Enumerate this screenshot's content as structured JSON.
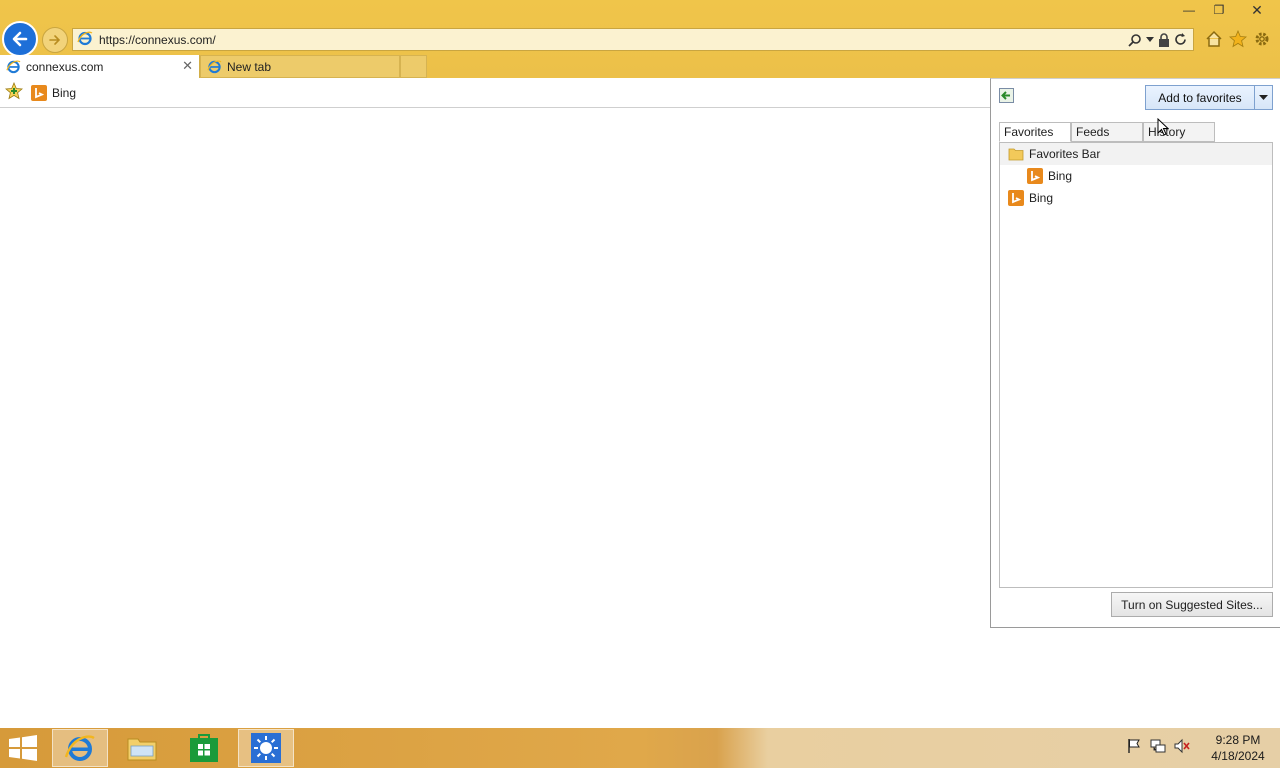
{
  "window": {
    "minimize_glyph": "—",
    "restore_glyph": "❐",
    "close_glyph": "✕"
  },
  "address": {
    "url": "https://connexus.com/"
  },
  "tabs": [
    {
      "label": "connexus.com",
      "close_glyph": "✕"
    },
    {
      "label": "New tab"
    }
  ],
  "favorites_bar": {
    "items": [
      {
        "label": "Bing",
        "icon": "bing-icon"
      }
    ]
  },
  "favorites_pane": {
    "add_button": "Add to favorites",
    "tabs": [
      "Favorites",
      "Feeds",
      "History"
    ],
    "tree": [
      {
        "label": "Favorites Bar",
        "icon": "folder-icon",
        "indent": 1
      },
      {
        "label": "Bing",
        "icon": "bing-icon",
        "indent": 2
      },
      {
        "label": "Bing",
        "icon": "bing-icon",
        "indent": 1
      }
    ],
    "suggested_button": "Turn on Suggested Sites..."
  },
  "taskbar": {
    "time": "9:28 PM",
    "date": "4/18/2024"
  },
  "colors": {
    "chrome": "#ecc049",
    "back_button": "#1d6fd8",
    "bing": "#e8891c",
    "ie_blue": "#1f7ad6"
  }
}
